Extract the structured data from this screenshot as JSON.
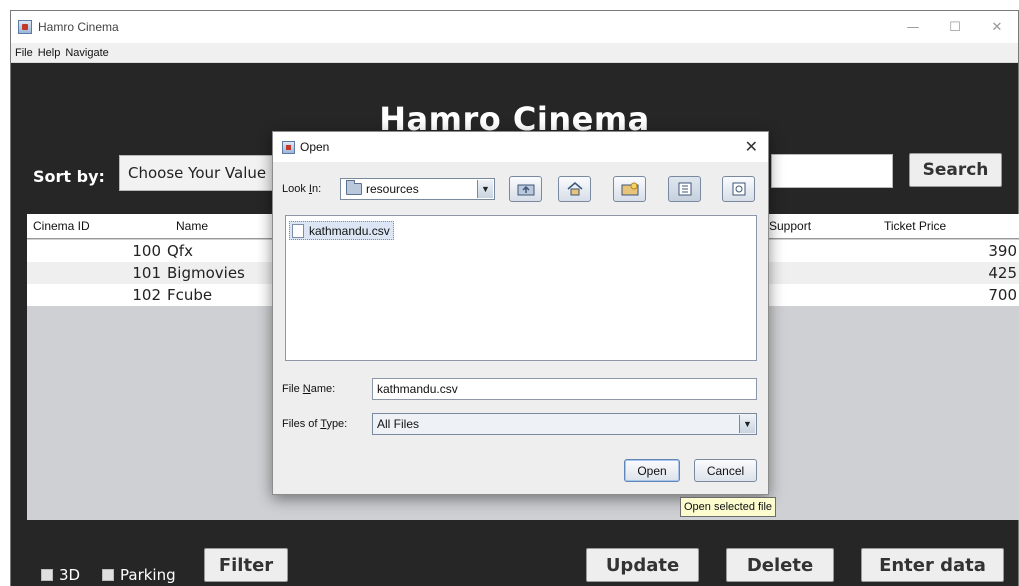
{
  "window": {
    "title": "Hamro Cinema",
    "controls": {
      "minimize": "—",
      "maximize": "☐",
      "close": "✕"
    }
  },
  "menubar": {
    "items": [
      "File",
      "Help",
      "Navigate"
    ]
  },
  "app": {
    "heading": "Hamro Cinema",
    "sort_label": "Sort by:",
    "sort_value": "Choose Your Value",
    "search_value": "",
    "search_label": "Search"
  },
  "table": {
    "columns": [
      "Cinema ID",
      "Name",
      "Support",
      "Ticket Price"
    ],
    "rows": [
      {
        "id": "100",
        "name": "Qfx",
        "price": "390"
      },
      {
        "id": "101",
        "name": "Bigmovies",
        "price": "425"
      },
      {
        "id": "102",
        "name": "Fcube",
        "price": "700"
      }
    ]
  },
  "bottom": {
    "check_3d": "3D",
    "check_parking": "Parking",
    "filter": "Filter",
    "update": "Update",
    "delete": "Delete",
    "enter_data": "Enter data"
  },
  "dialog": {
    "title": "Open",
    "close": "✕",
    "look_in_label_pre": "Look ",
    "look_in_label_key": "I",
    "look_in_label_post": "n:",
    "look_in_value": "resources",
    "toolbar_icons": [
      "up-folder-icon",
      "home-icon",
      "new-folder-icon",
      "list-view-icon",
      "details-view-icon"
    ],
    "files": [
      "kathmandu.csv"
    ],
    "file_name_label_pre": "File ",
    "file_name_label_key": "N",
    "file_name_label_post": "ame:",
    "file_name_value": "kathmandu.csv",
    "file_type_label_pre": "Files of ",
    "file_type_label_key": "T",
    "file_type_label_post": "ype:",
    "file_type_value": "All Files",
    "open_button": "Open",
    "cancel_button": "Cancel",
    "tooltip": "Open selected file"
  }
}
